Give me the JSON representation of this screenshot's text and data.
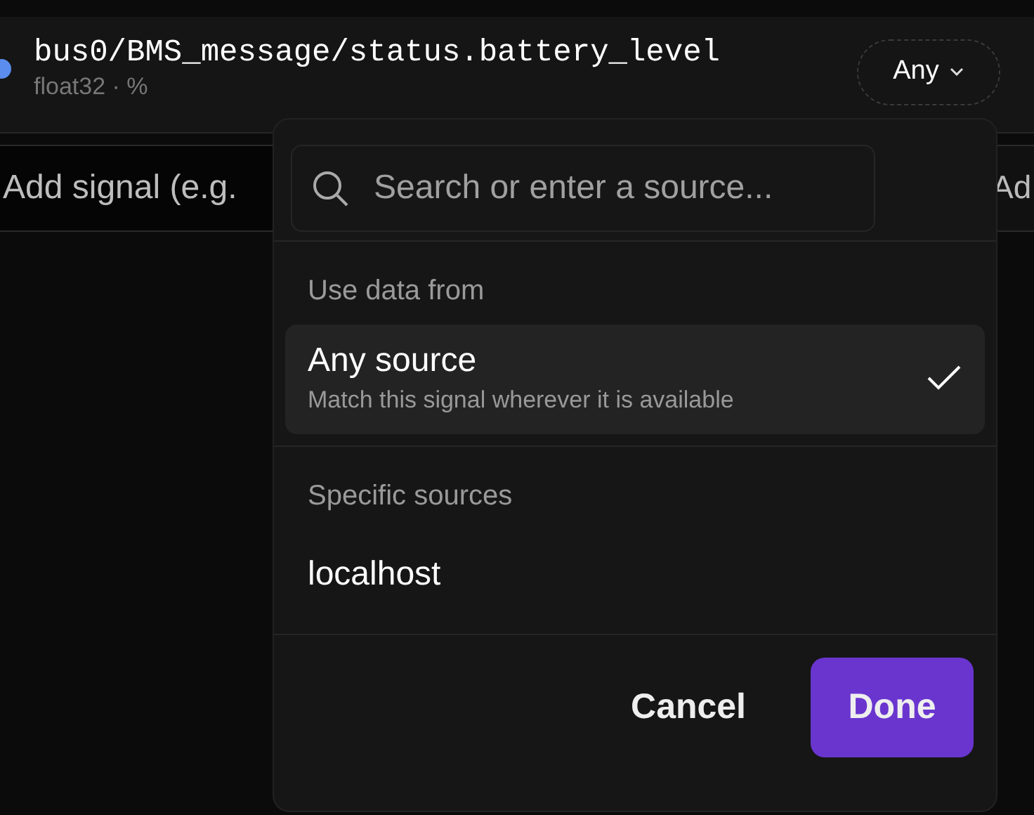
{
  "signal": {
    "name": "bus0/BMS_message/status.battery_level",
    "type": "float32 · %"
  },
  "source_button": {
    "label": "Any"
  },
  "add_signal": {
    "placeholder": "Add signal (e.g.",
    "button_label": "Ad"
  },
  "source_menu": {
    "search": {
      "placeholder": "Search or enter a source..."
    },
    "sections": [
      {
        "heading": "Use data from",
        "options": [
          {
            "label": "Any source",
            "description": "Match this signal wherever it is available",
            "selected": true
          }
        ]
      },
      {
        "heading": "Specific sources",
        "options": [
          {
            "label": "localhost",
            "selected": false
          }
        ]
      }
    ],
    "buttons": [
      {
        "label": "Cancel",
        "kind": "secondary"
      },
      {
        "label": "Done",
        "kind": "primary"
      }
    ]
  }
}
